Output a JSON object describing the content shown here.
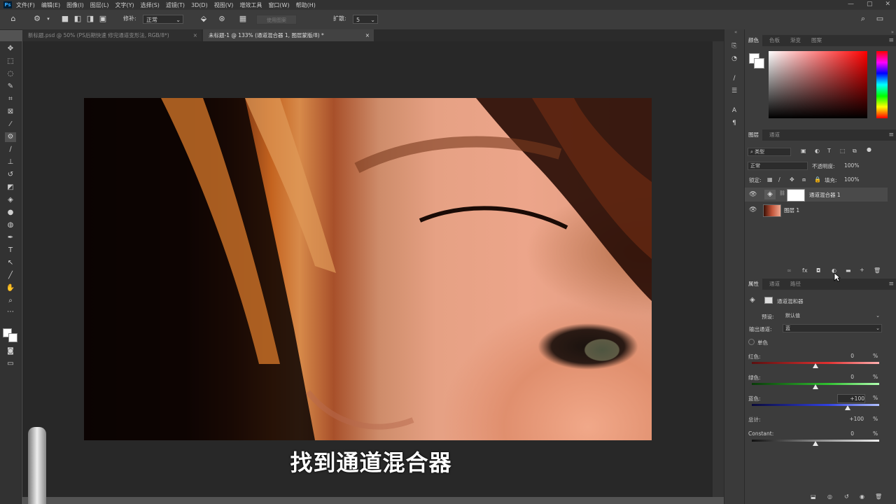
{
  "menubar": {
    "app_badge": "Ps",
    "items": [
      "文件(F)",
      "编辑(E)",
      "图像(I)",
      "图层(L)",
      "文字(Y)",
      "选择(S)",
      "滤镜(T)",
      "3D(D)",
      "视图(V)",
      "增效工具",
      "窗口(W)",
      "帮助(H)"
    ],
    "window_controls": [
      "—",
      "▢",
      "✕"
    ]
  },
  "options": {
    "mode_label": "修补:",
    "mode_value": "正常",
    "use_pattern_label": "使用图案",
    "diffuse_label": "扩散:",
    "diffuse_value": "5"
  },
  "tabs": [
    {
      "label": "新标题.psd @ 50% (PS后期快速 修完通道变形法, RGB/8*)",
      "close": "×"
    },
    {
      "label": "未标题-1 @ 133% (通道混合器 1, 图层蒙版/8) *",
      "close": "×"
    }
  ],
  "subtitle": "找到通道混合器",
  "color_panel": {
    "tabs": [
      "颜色",
      "色板",
      "渐变",
      "图案"
    ]
  },
  "layers_panel": {
    "tabs": [
      "图层",
      "通道"
    ],
    "filter_kind": "类型",
    "blend_mode": "正常",
    "opacity_label": "不透明度:",
    "opacity_value": "100%",
    "lock_label": "锁定:",
    "fill_label": "填充:",
    "fill_value": "100%",
    "layers": [
      {
        "name": "通道混合器 1"
      },
      {
        "name": "图层 1"
      }
    ],
    "bottom_icons": [
      "∞",
      "fx",
      "◘",
      "◐",
      "▬",
      "+",
      "🗑"
    ]
  },
  "properties_panel": {
    "tabs": [
      "属性",
      "通道",
      "路径"
    ],
    "title": "通道混和器",
    "preset_label": "预设:",
    "preset_value": "默认值",
    "output_label": "输出通道:",
    "output_value": "蓝",
    "mono_label": "单色",
    "red_label": "红色:",
    "red_value": "0",
    "green_label": "绿色:",
    "green_value": "0",
    "blue_label": "蓝色:",
    "blue_value": "+100",
    "total_label": "总计:",
    "total_value": "+100",
    "constant_label": "Constant:",
    "constant_value": "0",
    "pct": "%",
    "red_level": 50,
    "green_level": 50,
    "blue_level": 75,
    "constant_level": 50
  },
  "colors": {
    "panel_bg": "#3c3c3c",
    "dark_bg": "#282828",
    "accent": "#31a8ff"
  }
}
